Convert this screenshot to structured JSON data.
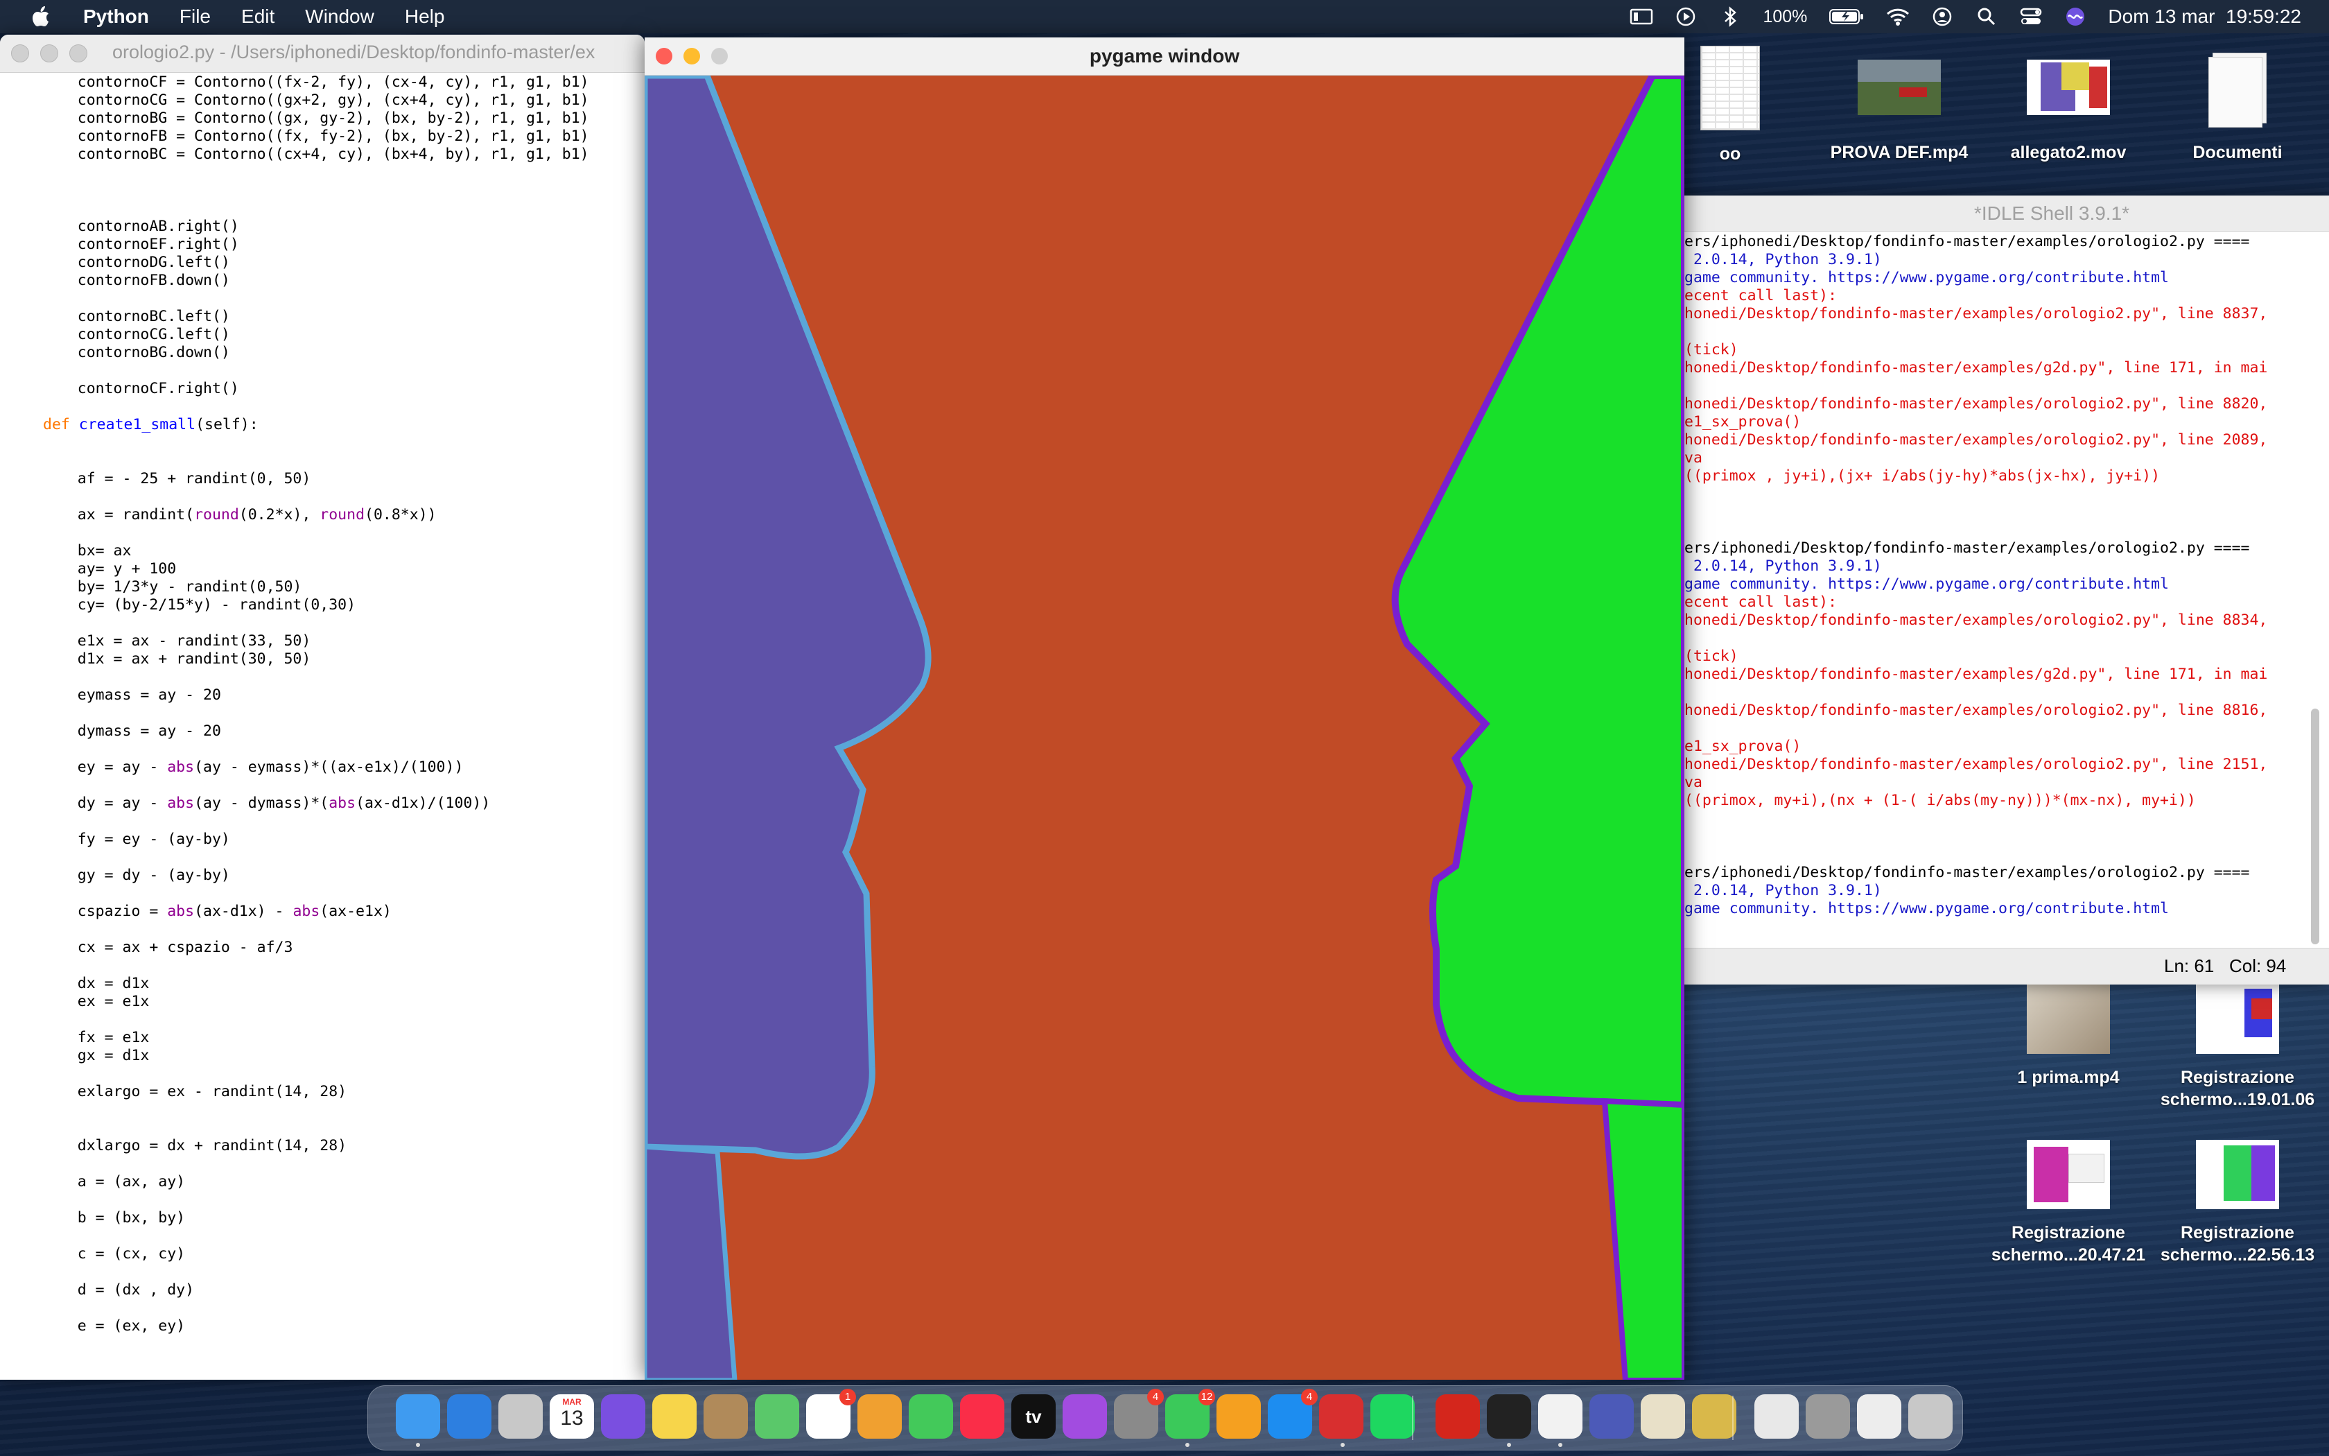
{
  "menubar": {
    "app_name": "Python",
    "menus": [
      "File",
      "Edit",
      "Window",
      "Help"
    ],
    "battery": "100%",
    "clock": "Dom 13 mar  19:59:22"
  },
  "editor": {
    "title": "orologio2.py - /Users/iphonedi/Desktop/fondinfo-master/ex",
    "lines": [
      "    contornoCF = Contorno((fx-2, fy), (cx-4, cy), r1, g1, b1)",
      "    contornoCG = Contorno((gx+2, gy), (cx+4, cy), r1, g1, b1)",
      "    contornoBG = Contorno((gx, gy-2), (bx, by-2), r1, g1, b1)",
      "    contornoFB = Contorno((fx, fy-2), (bx, by-2), r1, g1, b1)",
      "    contornoBC = Contorno((cx+4, cy), (bx+4, by), r1, g1, b1)",
      "    contornoAB.right()",
      "    contornoEF.right()",
      "    contornoDG.left()",
      "    contornoFB.down()",
      "    contornoBC.left()",
      "    contornoCG.left()",
      "    contornoBG.down()",
      "    contornoCF.right()",
      "create1_small",
      "(self):",
      "    af = - 25 + randint(0, 50)",
      "    ax = randint(round(0.2*x), round(0.8*x))",
      "    bx= ax",
      "    ay= y + 100",
      "    by= 1/3*y - randint(0,50)",
      "    cy= (by-2/15*y) - randint(0,30)",
      "    e1x = ax - randint(33, 50)",
      "    d1x = ax + randint(30, 50)",
      "    eymass = ay - 20",
      "    dymass = ay - 20",
      "    ey = ay - abs(ay - eymass)*((ax-e1x)/(100))",
      "    dy = ay - abs(ay - dymass)*(abs(ax-d1x)/(100))",
      "    fy = ey - (ay-by)",
      "    gy = dy - (ay-by)",
      "    cspazio = abs(ax-d1x) - abs(ax-e1x)",
      "    cx = ax + cspazio - af/3",
      "    dx = d1x",
      "    ex = e1x",
      "    fx = e1x",
      "    gx = d1x",
      "    exlargo = ex - randint(14, 28)",
      "    dxlargo = dx + randint(14, 28)",
      "    a = (ax, ay)",
      "    b = (bx, by)",
      "    c = (cx, cy)",
      "    d = (dx , dy)",
      "    e = (ex, ey)"
    ],
    "def_kw": "def"
  },
  "pygame": {
    "title": "pygame window",
    "colors": {
      "background": "#c14b26",
      "left_face": "#5e52a8",
      "left_outline": "#5aa6d8",
      "right_face": "#18e02a",
      "right_outline": "#7a1fd0"
    }
  },
  "shell": {
    "title": "*IDLE Shell 3.9.1*",
    "lines": [
      {
        "text": "ers/iphonedi/Desktop/fondinfo-master/examples/orologio2.py ====",
        "color": "black"
      },
      {
        "text": " 2.0.14, Python 3.9.1)",
        "color": "blue"
      },
      {
        "text": "game community. https://www.pygame.org/contribute.html",
        "color": "blue"
      },
      {
        "text": "ecent call last):",
        "color": "red"
      },
      {
        "text": "honedi/Desktop/fondinfo-master/examples/orologio2.py\", line 8837,",
        "color": "red"
      },
      {
        "text": "(tick)",
        "color": "red"
      },
      {
        "text": "honedi/Desktop/fondinfo-master/examples/g2d.py\", line 171, in mai",
        "color": "red"
      },
      {
        "text": "honedi/Desktop/fondinfo-master/examples/orologio2.py\", line 8820,",
        "color": "red"
      },
      {
        "text": "e1_sx_prova()",
        "color": "red"
      },
      {
        "text": "honedi/Desktop/fondinfo-master/examples/orologio2.py\", line 2089,",
        "color": "red"
      },
      {
        "text": "va",
        "color": "red"
      },
      {
        "text": "((primox , jy+i),(jx+ i/abs(jy-hy)*abs(jx-hx), jy+i))",
        "color": "red"
      },
      {
        "text": "ers/iphonedi/Desktop/fondinfo-master/examples/orologio2.py ====",
        "color": "black"
      },
      {
        "text": " 2.0.14, Python 3.9.1)",
        "color": "blue"
      },
      {
        "text": "game community. https://www.pygame.org/contribute.html",
        "color": "blue"
      },
      {
        "text": "ecent call last):",
        "color": "red"
      },
      {
        "text": "honedi/Desktop/fondinfo-master/examples/orologio2.py\", line 8834,",
        "color": "red"
      },
      {
        "text": "(tick)",
        "color": "red"
      },
      {
        "text": "honedi/Desktop/fondinfo-master/examples/g2d.py\", line 171, in mai",
        "color": "red"
      },
      {
        "text": "honedi/Desktop/fondinfo-master/examples/orologio2.py\", line 8816,",
        "color": "red"
      },
      {
        "text": "e1_sx_prova()",
        "color": "red"
      },
      {
        "text": "honedi/Desktop/fondinfo-master/examples/orologio2.py\", line 2151,",
        "color": "red"
      },
      {
        "text": "va",
        "color": "red"
      },
      {
        "text": "((primox, my+i),(nx + (1-( i/abs(my-ny)))*(mx-nx), my+i))",
        "color": "red"
      },
      {
        "text": "ers/iphonedi/Desktop/fondinfo-master/examples/orologio2.py ====",
        "color": "black"
      },
      {
        "text": " 2.0.14, Python 3.9.1)",
        "color": "blue"
      },
      {
        "text": "game community. https://www.pygame.org/contribute.html",
        "color": "blue"
      }
    ],
    "status": "Ln: 61   Col: 94"
  },
  "desktop_icons": [
    {
      "label": "oo"
    },
    {
      "label": "PROVA DEF.mp4"
    },
    {
      "label": "allegato2.mov"
    },
    {
      "label": "Documenti"
    },
    {
      "label": "1 prima.mp4"
    },
    {
      "label": "Registrazione schermo...19.01.06"
    },
    {
      "label": "Registrazione schermo...20.47.21"
    },
    {
      "label": "Registrazione schermo...22.56.13"
    }
  ],
  "dock": {
    "apps": [
      "finder-icon",
      "safari-icon",
      "launchpad-icon",
      "calendar-icon",
      "siri-icon",
      "notes-icon",
      "contacts-icon",
      "maps-icon",
      "reminders-icon",
      "photos-icon",
      "messages-icon",
      "music-icon",
      "tv-icon",
      "podcasts-icon",
      "system-preferences-icon",
      "facetime-icon",
      "pages-icon",
      "app-store-icon",
      "photo-booth-icon",
      "spotify-icon",
      "acrobat-icon",
      "terminal-icon",
      "textedit-icon",
      "teams-icon",
      "preview-icon",
      "python-launcher-icon",
      "documents-stack-icon",
      "downloads-stack-icon",
      "screen-stack-icon",
      "trash-icon"
    ],
    "calendar_month": "MAR",
    "calendar_day": "13",
    "tv_label": "tv",
    "badges": {
      "reminders": "1",
      "system-preferences": "4",
      "facetime": "12",
      "app-store": "4"
    }
  }
}
